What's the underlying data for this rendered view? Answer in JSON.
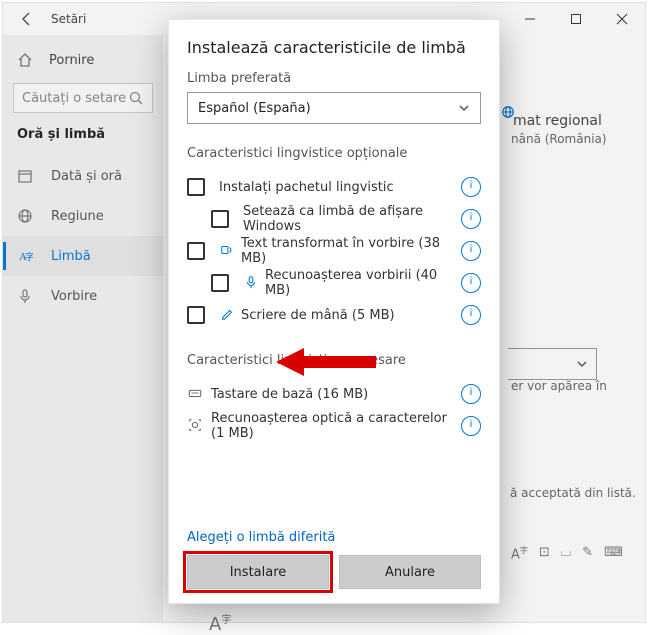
{
  "window": {
    "title": "Setări"
  },
  "sidebar": {
    "home": "Pornire",
    "search_placeholder": "Căutați o setare",
    "group_title": "Oră și limbă",
    "items": [
      {
        "label": "Dată și oră"
      },
      {
        "label": "Regiune"
      },
      {
        "label": "Limbă"
      },
      {
        "label": "Vorbire"
      }
    ]
  },
  "background": {
    "region_heading": "mat regional",
    "region_value": "nână (România)",
    "preview_note": "er vor apărea în",
    "list_note": "ă acceptată din listă."
  },
  "dialog": {
    "title": "Instalează caracteristicile de limbă",
    "preferred_label": "Limba preferată",
    "preferred_value": "Español (España)",
    "optional_title": "Caracteristici lingvistice opționale",
    "optional_features": [
      {
        "label": "Instalați pachetul lingvistic",
        "indent": false,
        "show_icon": false
      },
      {
        "label": "Setează ca limbă de afișare Windows",
        "indent": true,
        "show_icon": false
      },
      {
        "label": "Text transformat în vorbire (38 MB)",
        "indent": false,
        "show_icon": true,
        "icon_name": "text-to-speech-icon"
      },
      {
        "label": "Recunoașterea vorbirii (40 MB)",
        "indent": true,
        "show_icon": true,
        "icon_name": "microphone-icon"
      },
      {
        "label": "Scriere de mână (5 MB)",
        "indent": false,
        "show_icon": true,
        "icon_name": "handwriting-icon"
      }
    ],
    "required_title": "Caracteristici lingvistice necesare",
    "required_features": [
      {
        "label": "Tastare de bază (16 MB)",
        "icon_name": "keyboard-icon"
      },
      {
        "label": "Recunoașterea optică a caracterelor (1 MB)",
        "icon_name": "ocr-icon"
      }
    ],
    "choose_link": "Alegeți o limbă diferită",
    "install_btn": "Instalare",
    "cancel_btn": "Anulare"
  }
}
